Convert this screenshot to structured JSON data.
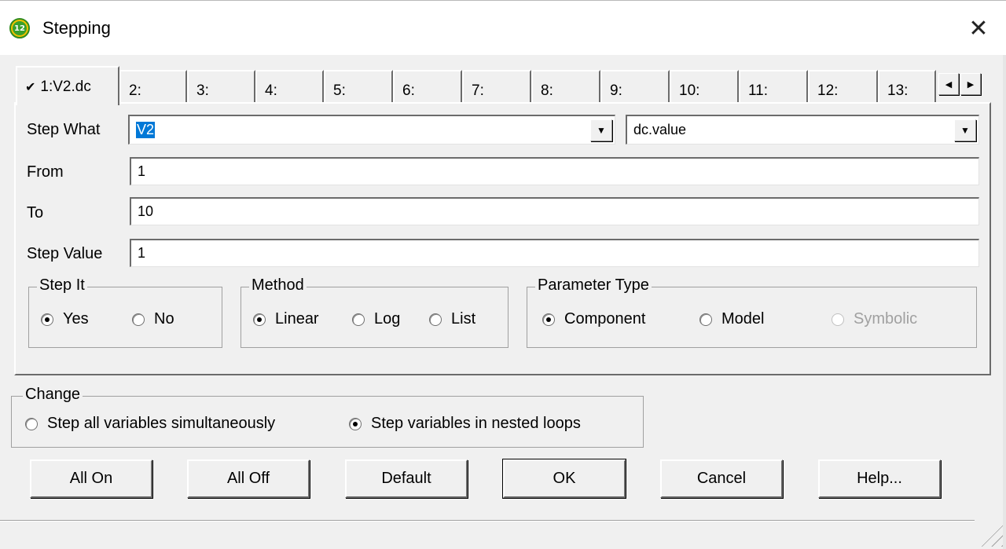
{
  "window": {
    "title": "Stepping",
    "icon_text": "12"
  },
  "tabs": [
    {
      "label": "1:V2.dc",
      "checked": true,
      "active": true
    },
    {
      "label": "2:"
    },
    {
      "label": "3:"
    },
    {
      "label": "4:"
    },
    {
      "label": "5:"
    },
    {
      "label": "6:"
    },
    {
      "label": "7:"
    },
    {
      "label": "8:"
    },
    {
      "label": "9:"
    },
    {
      "label": "10:"
    },
    {
      "label": "11:"
    },
    {
      "label": "12:"
    },
    {
      "label": "13:"
    }
  ],
  "tab_check_glyph": "✔",
  "tab_scroll": {
    "left": "◀",
    "right": "▶"
  },
  "form": {
    "step_what_label": "Step What",
    "step_what_component": "V2",
    "step_what_parameter": "dc.value",
    "from_label": "From",
    "from_value": "1",
    "to_label": "To",
    "to_value": "10",
    "step_value_label": "Step Value",
    "step_value": "1",
    "dropdown_glyph": "▼"
  },
  "step_it": {
    "title": "Step It",
    "yes": "Yes",
    "no": "No",
    "selected": "Yes"
  },
  "method": {
    "title": "Method",
    "linear": "Linear",
    "log": "Log",
    "list": "List",
    "selected": "Linear"
  },
  "parameter_type": {
    "title": "Parameter Type",
    "component": "Component",
    "model": "Model",
    "symbolic": "Symbolic",
    "selected": "Component",
    "symbolic_disabled": true
  },
  "change": {
    "title": "Change",
    "simultaneous": "Step all variables simultaneously",
    "nested": "Step variables in nested loops",
    "selected": "nested"
  },
  "buttons": {
    "all_on": "All On",
    "all_off": "All Off",
    "default": "Default",
    "ok": "OK",
    "cancel": "Cancel",
    "help": "Help..."
  },
  "close_glyph": "✕"
}
